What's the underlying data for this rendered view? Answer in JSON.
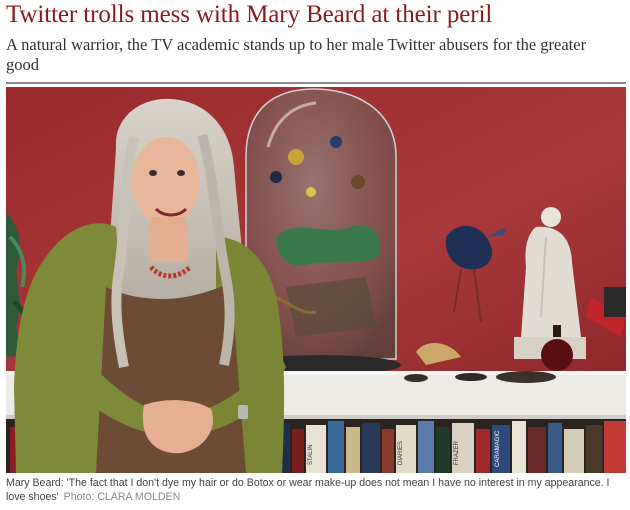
{
  "article": {
    "headline": "Twitter trolls mess with Mary Beard at their peril",
    "standfirst": "A natural warrior, the TV academic stands up to her male Twitter abusers for the greater good"
  },
  "figure": {
    "caption": "Mary Beard: 'The fact that I don't dye my hair or do Botox or wear make-up does not mean I have no interest in my appearance. I love shoes'",
    "credit": "Photo: CLARA MOLDEN",
    "book_spines": [
      "STALIN",
      "CARAMAGIC",
      "FRAZER",
      "DIARIES"
    ]
  },
  "colors": {
    "headline": "#8b1a1a",
    "wall": "#a12d2f",
    "shelf": "#ecebe6"
  }
}
